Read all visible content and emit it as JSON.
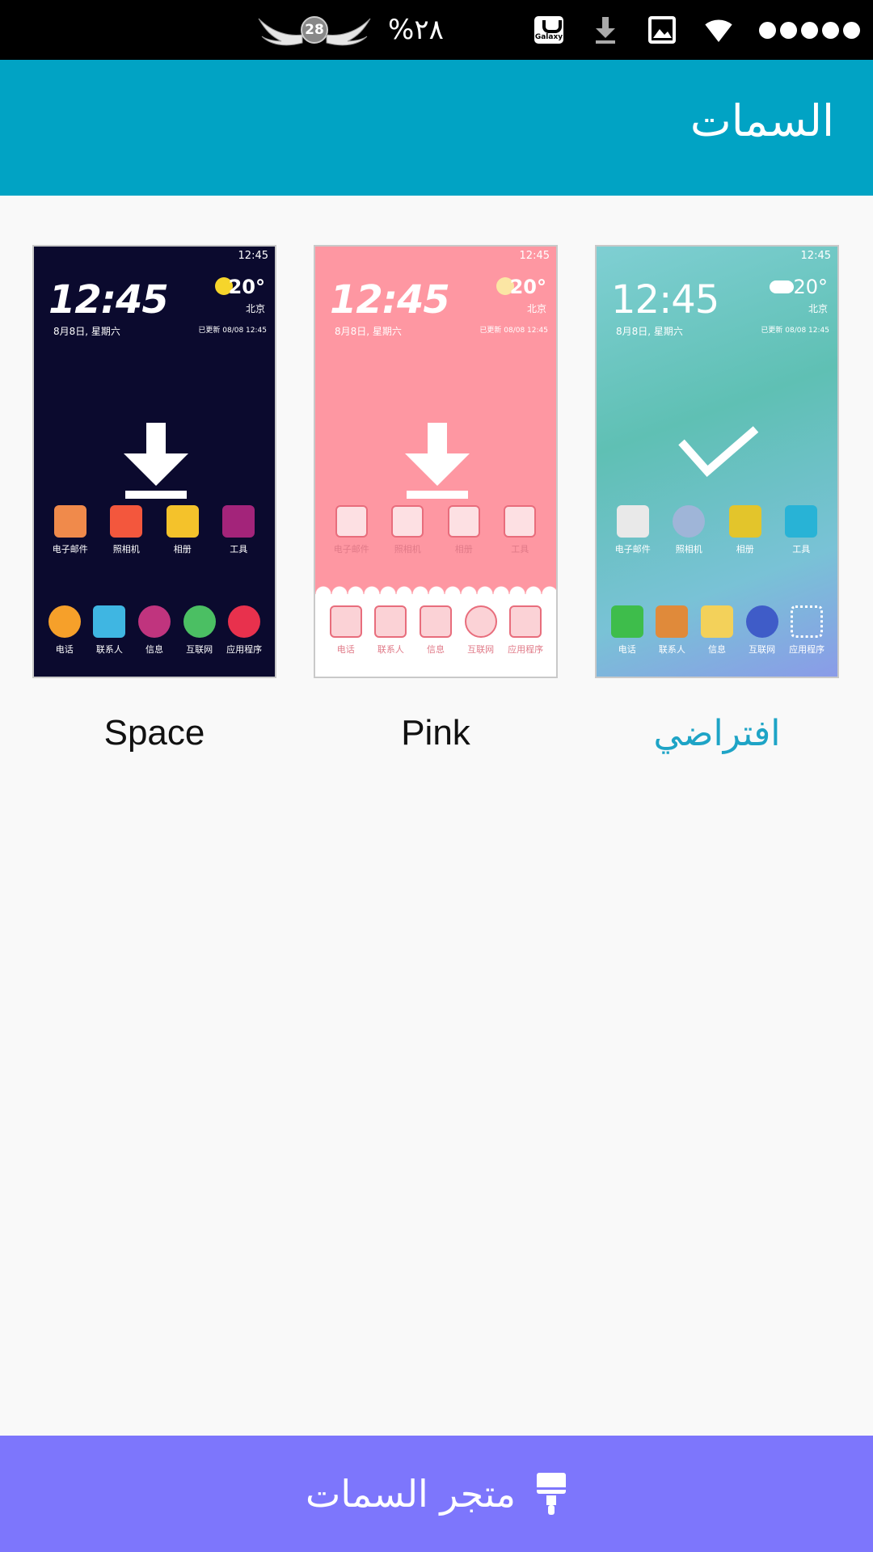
{
  "status_bar": {
    "battery_text": "%٢٨",
    "badge_number": "28",
    "galaxy_label": "Galaxy",
    "icons": [
      "galaxy-app-icon",
      "download-icon",
      "image-icon",
      "wifi-icon",
      "signal-dots-icon"
    ]
  },
  "header": {
    "title": "السمات"
  },
  "themes": [
    {
      "name": "Space",
      "state": "download",
      "preview": {
        "time": "12:45",
        "date": "8月8日, 星期六",
        "temp": "20°",
        "city": "北京",
        "updated": "已更新 08/08 12:45",
        "status_time": "12:45",
        "row1": [
          "电子邮件",
          "照相机",
          "相册",
          "工具"
        ],
        "row2": [
          "电话",
          "联系人",
          "信息",
          "互联网",
          "应用程序"
        ]
      }
    },
    {
      "name": "Pink",
      "state": "download",
      "preview": {
        "time": "12:45",
        "date": "8月8日, 星期六",
        "temp": "20°",
        "city": "北京",
        "updated": "已更新 08/08 12:45",
        "status_time": "12:45",
        "row1": [
          "电子邮件",
          "照相机",
          "相册",
          "工具"
        ],
        "row2": [
          "电话",
          "联系人",
          "信息",
          "互联网",
          "应用程序"
        ]
      }
    },
    {
      "name": "افتراضي",
      "state": "selected",
      "preview": {
        "time": "12:45",
        "date": "8月8日, 星期六",
        "temp": "20°",
        "city": "北京",
        "updated": "已更新 08/08 12:45",
        "status_time": "12:45",
        "row1": [
          "电子邮件",
          "照相机",
          "相册",
          "工具"
        ],
        "row2": [
          "电话",
          "联系人",
          "信息",
          "互联网",
          "应用程序"
        ]
      }
    }
  ],
  "footer": {
    "store_label": "متجر السمات",
    "icon": "paint-brush-icon"
  },
  "colors": {
    "header": "#01a3c4",
    "store_bar": "#7d76fc",
    "selected_label": "#1ea4c6"
  }
}
